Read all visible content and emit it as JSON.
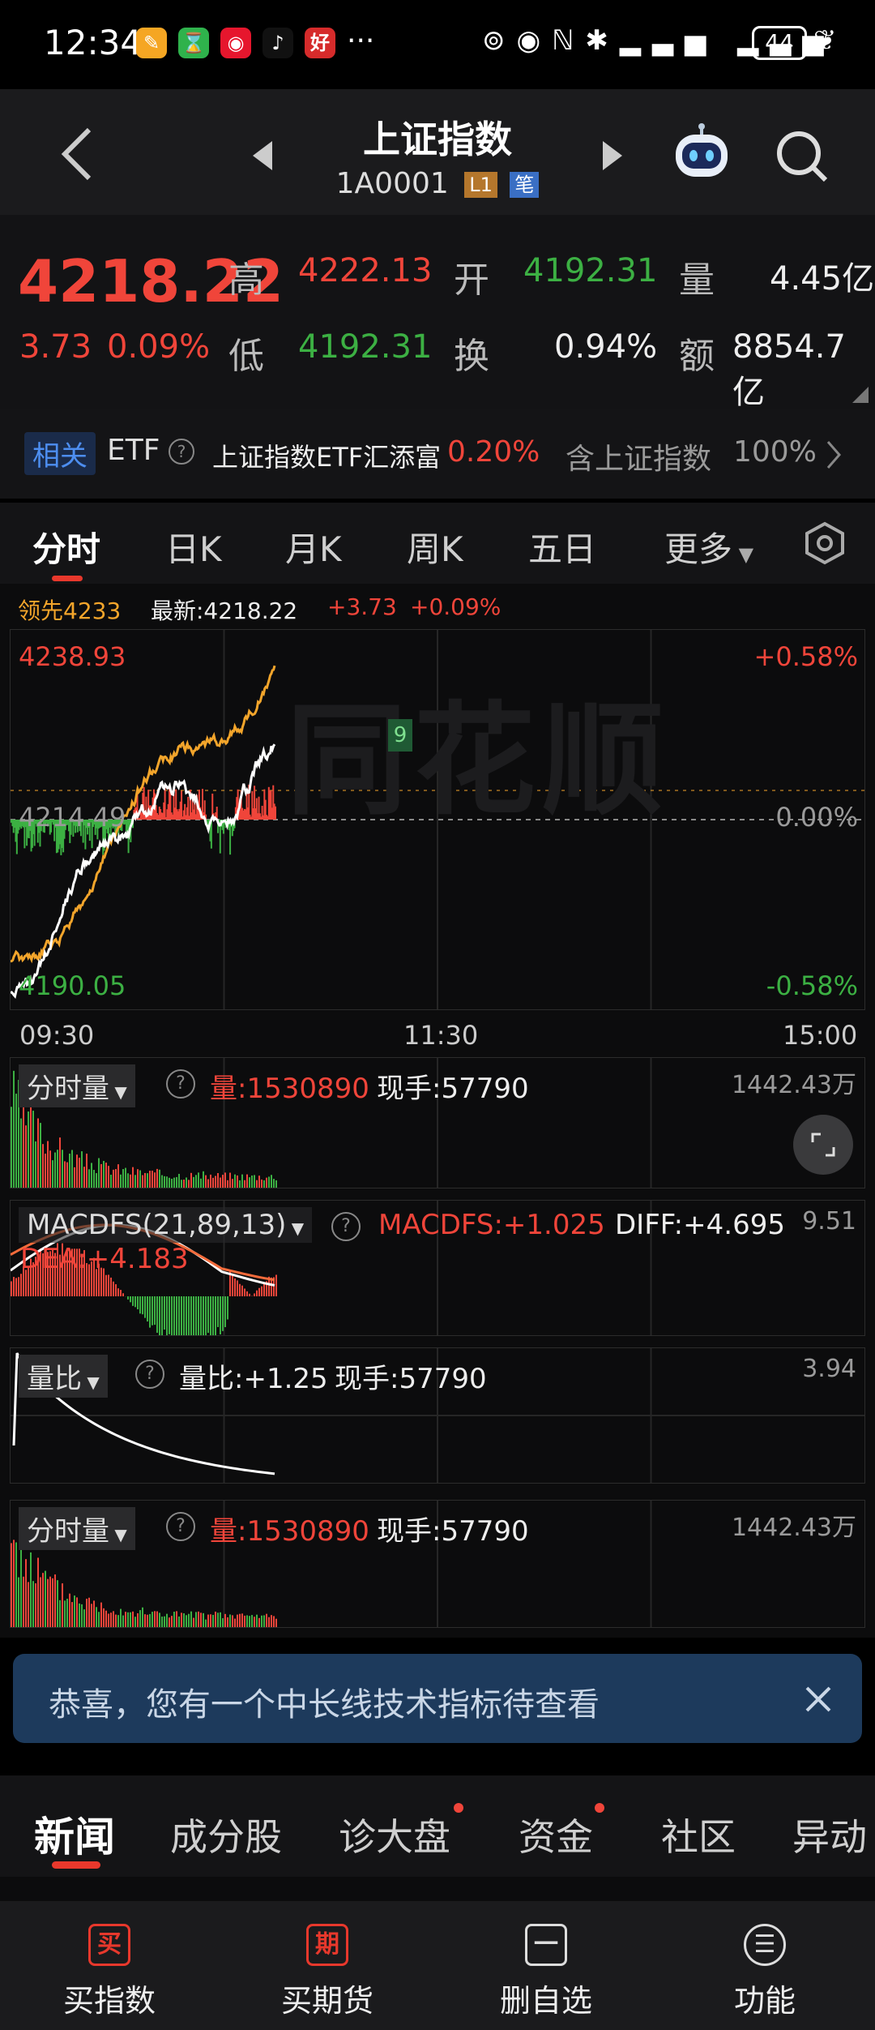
{
  "status": {
    "time": "12:34",
    "battery": "44"
  },
  "nav": {
    "title": "上证指数",
    "code": "1A0001",
    "tag_level": "L1",
    "tag_bi": "笔"
  },
  "quote": {
    "price": "4218.22",
    "change": "3.73",
    "change_pct": "0.09%",
    "high_label": "高",
    "high": "4222.13",
    "open_label": "开",
    "open": "4192.31",
    "vol_label": "量",
    "vol": "4.45亿",
    "low_label": "低",
    "low": "4192.31",
    "turnover_label": "换",
    "turnover": "0.94%",
    "amount_label": "额",
    "amount": "8854.7亿"
  },
  "etf": {
    "badge": "相关",
    "label": "ETF",
    "name": "上证指数ETF汇添富",
    "pct": "0.20%",
    "holding_label": "含上证指数",
    "holding": "100%"
  },
  "tabs": [
    "分时",
    "日K",
    "月K",
    "周K",
    "五日",
    "更多"
  ],
  "chart": {
    "lead_label": "领先4233",
    "latest_label": "最新:4218.22",
    "latest_change": "+3.73",
    "latest_pct": "+0.09%",
    "y_top": "4238.93",
    "y_mid": "4214.49",
    "y_bottom": "4190.05",
    "pct_top": "+0.58%",
    "pct_mid": "0.00%",
    "pct_bottom": "-0.58%",
    "x_start": "09:30",
    "x_mid": "11:30",
    "x_end": "15:00",
    "marker": "9",
    "watermark": "同花顺"
  },
  "panels": {
    "vol1": {
      "name": "分时量",
      "qty": "量:1530890",
      "hand": "现手:57790",
      "max": "1442.43万"
    },
    "macd": {
      "name": "MACDFS(21,89,13)",
      "macdfs": "MACDFS:+1.025",
      "diff": "DIFF:+4.695",
      "dea": "DEA:+4.183",
      "max": "9.51"
    },
    "ratio": {
      "name": "量比",
      "ratio": "量比:+1.25",
      "hand": "现手:57790",
      "max": "3.94"
    },
    "vol2": {
      "name": "分时量",
      "qty": "量:1530890",
      "hand": "现手:57790",
      "max": "1442.43万"
    }
  },
  "banner": {
    "text": "恭喜，您有一个中长线技术指标待查看"
  },
  "news_tabs": [
    "新闻",
    "成分股",
    "诊大盘",
    "资金",
    "社区",
    "异动"
  ],
  "bottom": [
    {
      "icon": "买",
      "label": "买指数"
    },
    {
      "icon": "期",
      "label": "买期货"
    },
    {
      "icon": "一",
      "label": "删自选"
    },
    {
      "icon": "☰",
      "label": "功能"
    }
  ],
  "colors": {
    "up": "#f0453a",
    "down": "#3cb043",
    "avg": "#f3a52b",
    "price": "#ffffff"
  }
}
